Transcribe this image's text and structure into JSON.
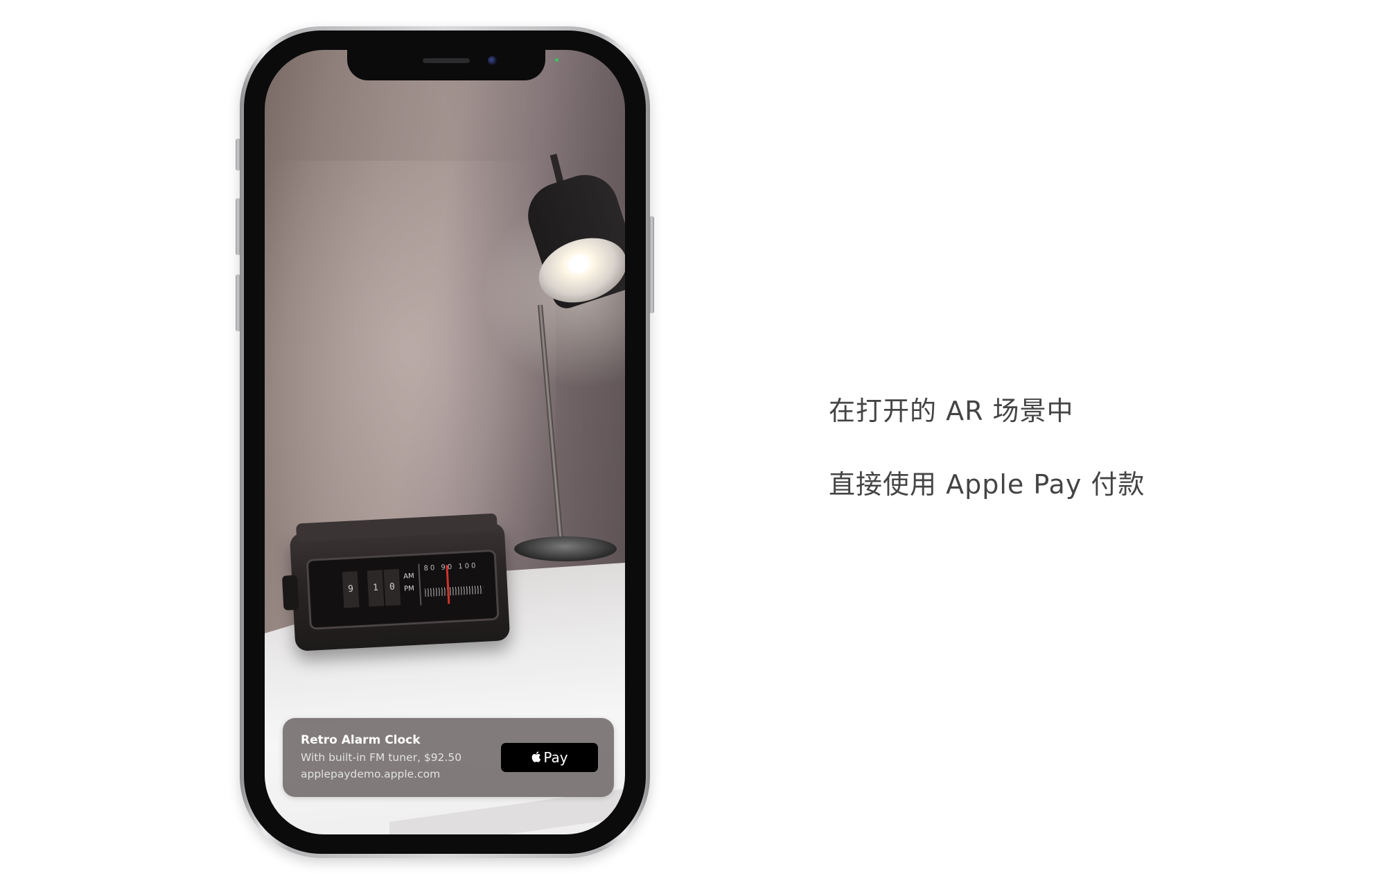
{
  "ar_quick_look": {
    "product_title": "Retro Alarm Clock",
    "product_subtitle": "With built-in FM tuner, $92.50",
    "merchant_domain": "applepaydemo.apple.com",
    "pay_button_label": "Pay",
    "pay_button_icon": "apple-logo-icon"
  },
  "scene": {
    "clock_digits": [
      "9",
      "1",
      "0"
    ],
    "clock_am": "AM",
    "clock_pm": "PM",
    "tuner_numbers": "80 90 100"
  },
  "captions": {
    "line1": "在打开的 AR 场景中",
    "line2": "直接使用 Apple Pay 付款"
  },
  "colors": {
    "caption_text": "#444444",
    "pay_button_bg": "#000000",
    "banner_bg": "#767070"
  }
}
